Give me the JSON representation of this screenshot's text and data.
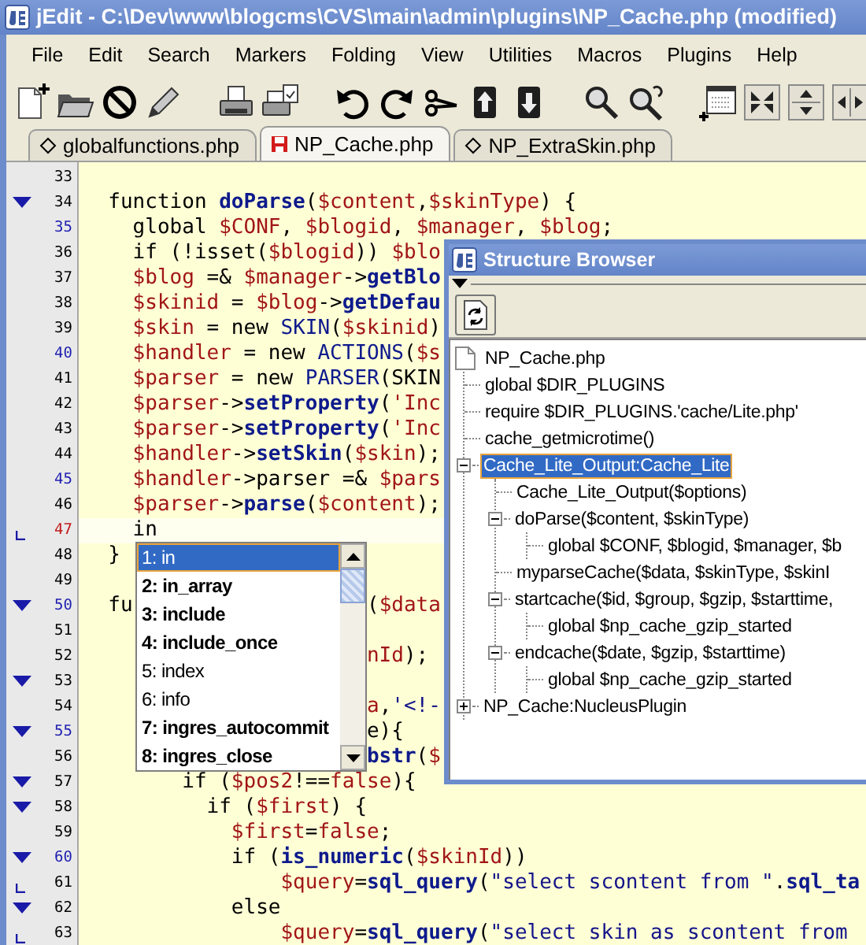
{
  "window": {
    "title": "jEdit - C:\\Dev\\www\\blogcms\\CVS\\main\\admin\\plugins\\NP_Cache.php (modified)"
  },
  "menu": [
    "File",
    "Edit",
    "Search",
    "Markers",
    "Folding",
    "View",
    "Utilities",
    "Macros",
    "Plugins",
    "Help"
  ],
  "tabs": [
    {
      "label": "globalfunctions.php",
      "modified": false,
      "selected": false
    },
    {
      "label": "NP_Cache.php",
      "modified": true,
      "selected": true
    },
    {
      "label": "NP_ExtraSkin.php",
      "modified": false,
      "selected": false
    }
  ],
  "editor": {
    "lines": [
      {
        "number": "33",
        "current": false,
        "highlighted": false
      },
      {
        "number": "34",
        "current": false,
        "highlighted": false,
        "fold": {
          "kind": "start"
        },
        "tokens": [
          {
            "kind": "plain",
            "text": "  function "
          },
          {
            "kind": "function",
            "text": "doParse"
          },
          {
            "kind": "plain",
            "text": "("
          },
          {
            "kind": "variable",
            "text": "$content"
          },
          {
            "kind": "plain",
            "text": ","
          },
          {
            "kind": "variable",
            "text": "$skinType"
          },
          {
            "kind": "plain",
            "text": ") {"
          }
        ]
      },
      {
        "number": "35",
        "current": false,
        "highlighted": true,
        "tokens": [
          {
            "kind": "plain",
            "text": "    global "
          },
          {
            "kind": "variable",
            "text": "$CONF"
          },
          {
            "kind": "plain",
            "text": ", "
          },
          {
            "kind": "variable",
            "text": "$blogid"
          },
          {
            "kind": "plain",
            "text": ", "
          },
          {
            "kind": "variable",
            "text": "$manager"
          },
          {
            "kind": "plain",
            "text": ", "
          },
          {
            "kind": "variable",
            "text": "$blog"
          },
          {
            "kind": "plain",
            "text": ";"
          }
        ]
      },
      {
        "number": "36",
        "current": false,
        "highlighted": false,
        "tokens": [
          {
            "kind": "plain",
            "text": "    if (!isset("
          },
          {
            "kind": "variable",
            "text": "$blogid"
          },
          {
            "kind": "plain",
            "text": ")) "
          },
          {
            "kind": "variable",
            "text": "$blo"
          }
        ]
      },
      {
        "number": "37",
        "current": false,
        "highlighted": false,
        "tokens": [
          {
            "kind": "variable",
            "text": "    $blog"
          },
          {
            "kind": "plain",
            "text": " =& "
          },
          {
            "kind": "variable",
            "text": "$manager"
          },
          {
            "kind": "plain",
            "text": "->"
          },
          {
            "kind": "function",
            "text": "getBlo"
          }
        ]
      },
      {
        "number": "38",
        "current": false,
        "highlighted": false,
        "tokens": [
          {
            "kind": "variable",
            "text": "    $skinid"
          },
          {
            "kind": "plain",
            "text": " = "
          },
          {
            "kind": "variable",
            "text": "$blog"
          },
          {
            "kind": "plain",
            "text": "->"
          },
          {
            "kind": "function",
            "text": "getDefau"
          }
        ]
      },
      {
        "number": "39",
        "current": false,
        "highlighted": false,
        "tokens": [
          {
            "kind": "variable",
            "text": "    $skin"
          },
          {
            "kind": "plain",
            "text": " = new "
          },
          {
            "kind": "class",
            "text": "SKIN"
          },
          {
            "kind": "plain",
            "text": "("
          },
          {
            "kind": "variable",
            "text": "$skinid"
          },
          {
            "kind": "plain",
            "text": ")"
          }
        ]
      },
      {
        "number": "40",
        "current": false,
        "highlighted": true,
        "tokens": [
          {
            "kind": "variable",
            "text": "    $handler"
          },
          {
            "kind": "plain",
            "text": " = new "
          },
          {
            "kind": "class",
            "text": "ACTIONS"
          },
          {
            "kind": "plain",
            "text": "("
          },
          {
            "kind": "variable",
            "text": "$s"
          }
        ]
      },
      {
        "number": "41",
        "current": false,
        "highlighted": false,
        "tokens": [
          {
            "kind": "variable",
            "text": "    $parser"
          },
          {
            "kind": "plain",
            "text": " = new "
          },
          {
            "kind": "class",
            "text": "PARSER"
          },
          {
            "kind": "plain",
            "text": "(SKIN"
          }
        ]
      },
      {
        "number": "42",
        "current": false,
        "highlighted": false,
        "tokens": [
          {
            "kind": "variable",
            "text": "    $parser"
          },
          {
            "kind": "plain",
            "text": "->"
          },
          {
            "kind": "function",
            "text": "setProperty"
          },
          {
            "kind": "plain",
            "text": "("
          },
          {
            "kind": "literal",
            "text": "'Inc"
          }
        ]
      },
      {
        "number": "43",
        "current": false,
        "highlighted": false,
        "tokens": [
          {
            "kind": "variable",
            "text": "    $parser"
          },
          {
            "kind": "plain",
            "text": "->"
          },
          {
            "kind": "function",
            "text": "setProperty"
          },
          {
            "kind": "plain",
            "text": "("
          },
          {
            "kind": "literal",
            "text": "'Inc"
          }
        ]
      },
      {
        "number": "44",
        "current": false,
        "highlighted": false,
        "tokens": [
          {
            "kind": "variable",
            "text": "    $handler"
          },
          {
            "kind": "plain",
            "text": "->"
          },
          {
            "kind": "function",
            "text": "setSkin"
          },
          {
            "kind": "plain",
            "text": "("
          },
          {
            "kind": "variable",
            "text": "$skin"
          },
          {
            "kind": "plain",
            "text": ");"
          }
        ]
      },
      {
        "number": "45",
        "current": false,
        "highlighted": true,
        "tokens": [
          {
            "kind": "variable",
            "text": "    $handler"
          },
          {
            "kind": "plain",
            "text": "->parser =& "
          },
          {
            "kind": "variable",
            "text": "$pars"
          }
        ]
      },
      {
        "number": "46",
        "current": false,
        "highlighted": false,
        "tokens": [
          {
            "kind": "variable",
            "text": "    $parser"
          },
          {
            "kind": "plain",
            "text": "->"
          },
          {
            "kind": "function",
            "text": "parse"
          },
          {
            "kind": "plain",
            "text": "("
          },
          {
            "kind": "variable",
            "text": "$content"
          },
          {
            "kind": "plain",
            "text": ");"
          }
        ]
      },
      {
        "number": "47",
        "current": true,
        "highlighted": false,
        "fold": {
          "kind": "end"
        },
        "tokens": [
          {
            "kind": "plain",
            "text": "    in"
          }
        ]
      },
      {
        "number": "48",
        "current": false,
        "highlighted": false,
        "tokens": [
          {
            "kind": "plain",
            "text": "  }"
          }
        ]
      },
      {
        "number": "49",
        "current": false,
        "highlighted": false
      },
      {
        "number": "50",
        "current": false,
        "highlighted": true,
        "fold": {
          "kind": "start"
        },
        "tokens": [
          {
            "kind": "plain",
            "text": "  fu"
          }
        ],
        "resume": [
          {
            "kind": "plain",
            "text": "("
          },
          {
            "kind": "variable",
            "text": "$data"
          }
        ]
      },
      {
        "number": "51",
        "current": false,
        "highlighted": false
      },
      {
        "number": "52",
        "current": false,
        "highlighted": false,
        "resume": [
          {
            "kind": "variable",
            "text": "nId"
          },
          {
            "kind": "plain",
            "text": ");"
          }
        ]
      },
      {
        "number": "53",
        "current": false,
        "highlighted": false,
        "fold": {
          "kind": "start"
        }
      },
      {
        "number": "54",
        "current": false,
        "highlighted": false,
        "resume": [
          {
            "kind": "variable",
            "text": "a"
          },
          {
            "kind": "plain",
            "text": ","
          },
          {
            "kind": "string",
            "text": "'<!-"
          }
        ]
      },
      {
        "number": "55",
        "current": false,
        "highlighted": true,
        "fold": {
          "kind": "start"
        },
        "resume": [
          {
            "kind": "plain",
            "text": "e){"
          }
        ]
      },
      {
        "number": "56",
        "current": false,
        "highlighted": false,
        "resume": [
          {
            "kind": "function",
            "text": "bstr"
          },
          {
            "kind": "plain",
            "text": "("
          },
          {
            "kind": "variable",
            "text": "$"
          }
        ]
      },
      {
        "number": "57",
        "current": false,
        "highlighted": false,
        "fold": {
          "kind": "start"
        },
        "tokens": [
          {
            "kind": "plain",
            "text": "        if ("
          },
          {
            "kind": "variable",
            "text": "$pos2"
          },
          {
            "kind": "plain",
            "text": "!=="
          },
          {
            "kind": "literal",
            "text": "false"
          },
          {
            "kind": "plain",
            "text": "){"
          }
        ]
      },
      {
        "number": "58",
        "current": false,
        "highlighted": false,
        "fold": {
          "kind": "start"
        },
        "tokens": [
          {
            "kind": "plain",
            "text": "          if ("
          },
          {
            "kind": "variable",
            "text": "$first"
          },
          {
            "kind": "plain",
            "text": ") {"
          }
        ]
      },
      {
        "number": "59",
        "current": false,
        "highlighted": false,
        "tokens": [
          {
            "kind": "variable",
            "text": "            $first"
          },
          {
            "kind": "plain",
            "text": "="
          },
          {
            "kind": "literal",
            "text": "false"
          },
          {
            "kind": "plain",
            "text": ";"
          }
        ]
      },
      {
        "number": "60",
        "current": false,
        "highlighted": true,
        "fold": {
          "kind": "start"
        },
        "tokens": [
          {
            "kind": "plain",
            "text": "            if ("
          },
          {
            "kind": "function",
            "text": "is_numeric"
          },
          {
            "kind": "plain",
            "text": "("
          },
          {
            "kind": "variable",
            "text": "$skinId"
          },
          {
            "kind": "plain",
            "text": "))"
          }
        ]
      },
      {
        "number": "61",
        "current": false,
        "highlighted": false,
        "fold": {
          "kind": "end"
        },
        "tokens": [
          {
            "kind": "variable",
            "text": "                $query"
          },
          {
            "kind": "plain",
            "text": "="
          },
          {
            "kind": "function",
            "text": "sql_query"
          },
          {
            "kind": "plain",
            "text": "("
          },
          {
            "kind": "string",
            "text": "\"select scontent from \""
          },
          {
            "kind": "plain",
            "text": "."
          },
          {
            "kind": "function",
            "text": "sql_ta"
          }
        ]
      },
      {
        "number": "62",
        "current": false,
        "highlighted": false,
        "fold": {
          "kind": "start"
        },
        "tokens": [
          {
            "kind": "plain",
            "text": "            else"
          }
        ]
      },
      {
        "number": "63",
        "current": false,
        "highlighted": false,
        "fold": {
          "kind": "end"
        },
        "tokens": [
          {
            "kind": "variable",
            "text": "                $query"
          },
          {
            "kind": "plain",
            "text": "="
          },
          {
            "kind": "function",
            "text": "sql_query"
          },
          {
            "kind": "plain",
            "text": "("
          },
          {
            "kind": "string",
            "text": "\"select skin as scontent from"
          }
        ]
      }
    ]
  },
  "completion_popup": {
    "items": [
      {
        "text": "1: in",
        "bold": false,
        "selected": true
      },
      {
        "text": "2: in_array",
        "bold": true,
        "selected": false
      },
      {
        "text": "3: include",
        "bold": true,
        "selected": false
      },
      {
        "text": "4: include_once",
        "bold": true,
        "selected": false
      },
      {
        "text": "5: index",
        "bold": false,
        "selected": false
      },
      {
        "text": "6: info",
        "bold": false,
        "selected": false
      },
      {
        "text": "7: ingres_autocommit",
        "bold": true,
        "selected": false
      },
      {
        "text": "8: ingres_close",
        "bold": true,
        "selected": false
      }
    ]
  },
  "structure_browser": {
    "title": "Structure Browser",
    "tree": [
      {
        "label": "NP_Cache.php",
        "kind": "file",
        "selected": false,
        "children": [
          {
            "label": "global $DIR_PLUGINS",
            "selected": false
          },
          {
            "label": "require $DIR_PLUGINS.'cache/Lite.php'",
            "selected": false
          },
          {
            "label": "cache_getmicrotime()",
            "selected": false
          },
          {
            "label": "Cache_Lite_Output:Cache_Lite",
            "selected": true,
            "expanded": true,
            "children": [
              {
                "label": "Cache_Lite_Output($options)",
                "selected": false
              },
              {
                "label": "doParse($content, $skinType)",
                "selected": false,
                "expanded": true,
                "children": [
                  {
                    "label": "global $CONF, $blogid, $manager, $b",
                    "selected": false
                  }
                ]
              },
              {
                "label": "myparseCache($data, $skinType, $skinI",
                "selected": false
              },
              {
                "label": "startcache($id, $group, $gzip, $starttime,",
                "selected": false,
                "expanded": true,
                "children": [
                  {
                    "label": "global $np_cache_gzip_started",
                    "selected": false
                  }
                ]
              },
              {
                "label": "endcache($date, $gzip, $starttime)",
                "selected": false,
                "expanded": true,
                "children": [
                  {
                    "label": "global $np_cache_gzip_started",
                    "selected": false
                  }
                ]
              }
            ]
          },
          {
            "label": "NP_Cache:NucleusPlugin",
            "selected": false,
            "expanded": false
          }
        ]
      }
    ]
  }
}
